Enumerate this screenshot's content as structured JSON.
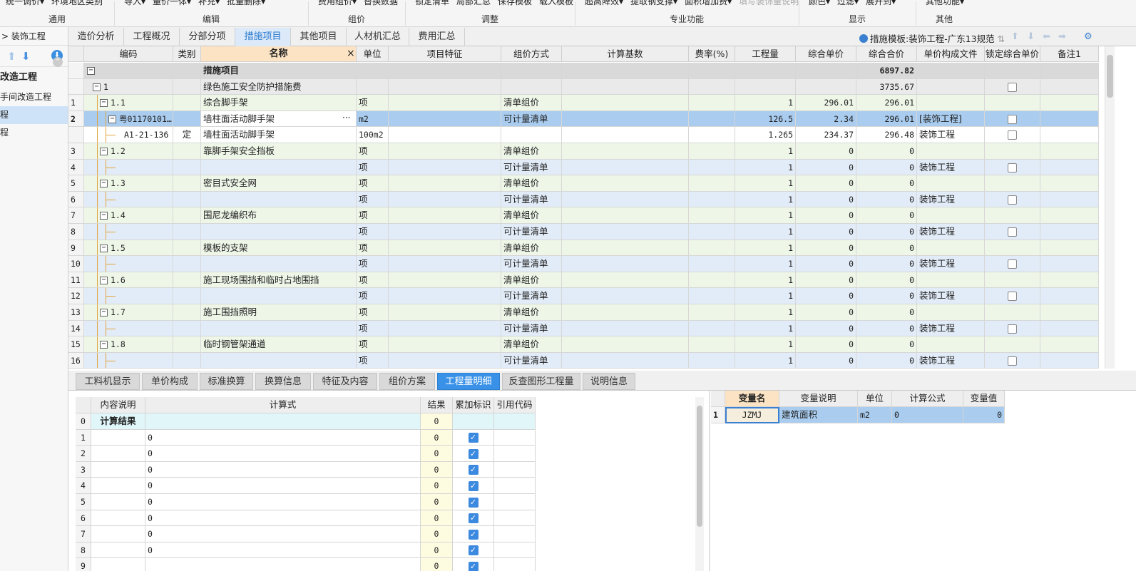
{
  "ribbon": {
    "groups": [
      {
        "name": "tongyong",
        "top": [
          "统一调价▾",
          "环境地区类别"
        ],
        "label": "通用"
      },
      {
        "name": "bianji",
        "top": [
          "导入▾",
          "量价一体▾",
          "补充▾",
          "批量删除▾"
        ],
        "label": "编辑"
      },
      {
        "name": "zujia",
        "top": [
          "费用组价▾",
          "替换数据"
        ],
        "label": "组价"
      },
      {
        "name": "tiaozheng",
        "top": [
          "锁定清单",
          "局部汇总",
          "保存模板",
          "载入模板"
        ],
        "label": "调整"
      },
      {
        "name": "zhuanye",
        "top": [
          "超高降效▾",
          "提取钢支撑▾",
          "面积增加费▾",
          "填写装饰量说明"
        ],
        "label": "专业功能"
      },
      {
        "name": "xianshi",
        "top": [
          "颜色▾",
          "过滤▾",
          "展开到▾"
        ],
        "label": "显示"
      },
      {
        "name": "qita",
        "top": [
          "其他功能▾"
        ],
        "label": "其他"
      }
    ]
  },
  "left": {
    "breadcrumb": "> 装饰工程",
    "tree": [
      {
        "text": "改造工程",
        "bold": true,
        "selected": false
      },
      {
        "text": "手间改造工程",
        "bold": false,
        "selected": false
      },
      {
        "text": "程",
        "bold": false,
        "selected": true
      },
      {
        "text": "程",
        "bold": false,
        "selected": false
      }
    ]
  },
  "tabs": [
    "造价分析",
    "工程概况",
    "分部分项",
    "措施项目",
    "其他项目",
    "人材机汇总",
    "费用汇总"
  ],
  "active_tab": 3,
  "template_label": "措施模板:装饰工程-广东13规范",
  "grid": {
    "columns": [
      "",
      "编码",
      "类别",
      "名称",
      "单位",
      "项目特征",
      "组价方式",
      "计算基数",
      "费率(%)",
      "工程量",
      "综合单价",
      "综合合价",
      "单价构成文件",
      "锁定综合单价",
      "备注1"
    ],
    "rows": [
      {
        "no": "",
        "lvl": 0,
        "tog": "−",
        "code": "",
        "type": "",
        "name": "措施项目",
        "unit": "",
        "method": "",
        "qty": "",
        "price": "",
        "total": "6897.82",
        "file": "",
        "lock": false,
        "style": "group0"
      },
      {
        "no": "",
        "lvl": 1,
        "tog": "−",
        "code": "1",
        "type": "",
        "name": "绿色施工安全防护措施费",
        "unit": "",
        "method": "",
        "qty": "",
        "price": "",
        "total": "3735.67",
        "file": "",
        "lock": true,
        "style": "group1"
      },
      {
        "no": "1",
        "lvl": 2,
        "tog": "−",
        "code": "1.1",
        "type": "",
        "name": "综合脚手架",
        "unit": "项",
        "method": "清单组价",
        "qty": "1",
        "price": "296.01",
        "total": "296.01",
        "file": "",
        "lock": false,
        "style": "green"
      },
      {
        "no": "2",
        "lvl": 3,
        "tog": "−",
        "code": "粤01170101…",
        "type": "",
        "name": "墙柱面活动脚手架",
        "unit": "m2",
        "method": "可计量清单",
        "qty": "126.5",
        "price": "2.34",
        "total": "296.01",
        "file": "[装饰工程]",
        "lock": true,
        "style": "sel"
      },
      {
        "no": "",
        "lvl": 4,
        "tog": "",
        "code": "A1-21-136",
        "type": "定",
        "name": "墙柱面活动脚手架",
        "unit": "100m2",
        "method": "",
        "qty": "1.265",
        "price": "234.37",
        "total": "296.48",
        "file": "装饰工程",
        "lock": true,
        "style": "white"
      },
      {
        "no": "3",
        "lvl": 2,
        "tog": "−",
        "code": "1.2",
        "type": "",
        "name": "靠脚手架安全挡板",
        "unit": "项",
        "method": "清单组价",
        "qty": "1",
        "price": "0",
        "total": "0",
        "file": "",
        "lock": false,
        "style": "green"
      },
      {
        "no": "4",
        "lvl": 3,
        "tog": "",
        "code": "",
        "type": "",
        "name": "",
        "unit": "项",
        "method": "可计量清单",
        "qty": "1",
        "price": "0",
        "total": "0",
        "file": "装饰工程",
        "lock": true,
        "style": "blue"
      },
      {
        "no": "5",
        "lvl": 2,
        "tog": "−",
        "code": "1.3",
        "type": "",
        "name": "密目式安全网",
        "unit": "项",
        "method": "清单组价",
        "qty": "1",
        "price": "0",
        "total": "0",
        "file": "",
        "lock": false,
        "style": "green"
      },
      {
        "no": "6",
        "lvl": 3,
        "tog": "",
        "code": "",
        "type": "",
        "name": "",
        "unit": "项",
        "method": "可计量清单",
        "qty": "1",
        "price": "0",
        "total": "0",
        "file": "装饰工程",
        "lock": true,
        "style": "blue"
      },
      {
        "no": "7",
        "lvl": 2,
        "tog": "−",
        "code": "1.4",
        "type": "",
        "name": "围尼龙编织布",
        "unit": "项",
        "method": "清单组价",
        "qty": "1",
        "price": "0",
        "total": "0",
        "file": "",
        "lock": false,
        "style": "green"
      },
      {
        "no": "8",
        "lvl": 3,
        "tog": "",
        "code": "",
        "type": "",
        "name": "",
        "unit": "项",
        "method": "可计量清单",
        "qty": "1",
        "price": "0",
        "total": "0",
        "file": "装饰工程",
        "lock": true,
        "style": "blue"
      },
      {
        "no": "9",
        "lvl": 2,
        "tog": "−",
        "code": "1.5",
        "type": "",
        "name": "模板的支架",
        "unit": "项",
        "method": "清单组价",
        "qty": "1",
        "price": "0",
        "total": "0",
        "file": "",
        "lock": false,
        "style": "green"
      },
      {
        "no": "10",
        "lvl": 3,
        "tog": "",
        "code": "",
        "type": "",
        "name": "",
        "unit": "项",
        "method": "可计量清单",
        "qty": "1",
        "price": "0",
        "total": "0",
        "file": "装饰工程",
        "lock": true,
        "style": "blue"
      },
      {
        "no": "11",
        "lvl": 2,
        "tog": "−",
        "code": "1.6",
        "type": "",
        "name": "施工现场围挡和临时占地围挡",
        "unit": "项",
        "method": "清单组价",
        "qty": "1",
        "price": "0",
        "total": "0",
        "file": "",
        "lock": false,
        "style": "green"
      },
      {
        "no": "12",
        "lvl": 3,
        "tog": "",
        "code": "",
        "type": "",
        "name": "",
        "unit": "项",
        "method": "可计量清单",
        "qty": "1",
        "price": "0",
        "total": "0",
        "file": "装饰工程",
        "lock": true,
        "style": "blue"
      },
      {
        "no": "13",
        "lvl": 2,
        "tog": "−",
        "code": "1.7",
        "type": "",
        "name": "施工围挡照明",
        "unit": "项",
        "method": "清单组价",
        "qty": "1",
        "price": "0",
        "total": "0",
        "file": "",
        "lock": false,
        "style": "green"
      },
      {
        "no": "14",
        "lvl": 3,
        "tog": "",
        "code": "",
        "type": "",
        "name": "",
        "unit": "项",
        "method": "可计量清单",
        "qty": "1",
        "price": "0",
        "total": "0",
        "file": "装饰工程",
        "lock": true,
        "style": "blue"
      },
      {
        "no": "15",
        "lvl": 2,
        "tog": "−",
        "code": "1.8",
        "type": "",
        "name": "临时钢管架通道",
        "unit": "项",
        "method": "清单组价",
        "qty": "1",
        "price": "0",
        "total": "0",
        "file": "",
        "lock": false,
        "style": "green"
      },
      {
        "no": "16",
        "lvl": 3,
        "tog": "",
        "code": "",
        "type": "",
        "name": "",
        "unit": "项",
        "method": "可计量清单",
        "qty": "1",
        "price": "0",
        "total": "0",
        "file": "装饰工程",
        "lock": true,
        "style": "blue"
      }
    ]
  },
  "bottom_tabs": [
    "工料机显示",
    "单价构成",
    "标准换算",
    "换算信息",
    "特征及内容",
    "组价方案",
    "工程量明细",
    "反查图形工程量",
    "说明信息"
  ],
  "bottom_active": 6,
  "qty_detail": {
    "columns": [
      "",
      "内容说明",
      "计算式",
      "结果",
      "累加标识",
      "引用代码"
    ],
    "rows": [
      {
        "no": "0",
        "desc": "计算结果",
        "formula": "",
        "result": "0",
        "checked": false,
        "bold": true
      },
      {
        "no": "1",
        "desc": "",
        "formula": "0",
        "result": "0",
        "checked": true
      },
      {
        "no": "2",
        "desc": "",
        "formula": "0",
        "result": "0",
        "checked": true
      },
      {
        "no": "3",
        "desc": "",
        "formula": "0",
        "result": "0",
        "checked": true
      },
      {
        "no": "4",
        "desc": "",
        "formula": "0",
        "result": "0",
        "checked": true
      },
      {
        "no": "5",
        "desc": "",
        "formula": "0",
        "result": "0",
        "checked": true
      },
      {
        "no": "6",
        "desc": "",
        "formula": "0",
        "result": "0",
        "checked": true
      },
      {
        "no": "7",
        "desc": "",
        "formula": "0",
        "result": "0",
        "checked": true
      },
      {
        "no": "8",
        "desc": "",
        "formula": "0",
        "result": "0",
        "checked": true
      },
      {
        "no": "9",
        "desc": "",
        "formula": "",
        "result": "0",
        "checked": true
      }
    ]
  },
  "variables": {
    "columns": [
      "",
      "变量名",
      "变量说明",
      "单位",
      "计算公式",
      "变量值"
    ],
    "rows": [
      {
        "no": "1",
        "name": "JZMJ",
        "desc": "建筑面积",
        "unit": "m2",
        "formula": "0",
        "value": "0"
      }
    ]
  },
  "colors": {
    "accent": "#3a92e8",
    "green_row": "#eef6e8",
    "blue_row": "#e2ecf8",
    "group_row": "#d9d9d9",
    "selected_row": "#a9ccef"
  }
}
